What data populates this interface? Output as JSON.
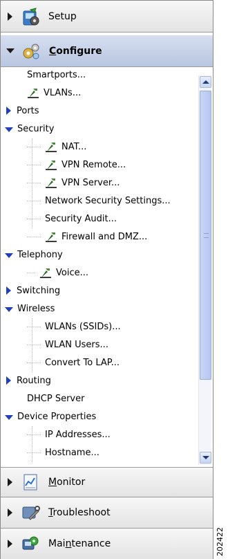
{
  "sections": {
    "setup": {
      "label": "Setup"
    },
    "configure": {
      "label": "Configure",
      "mnemonic": "C",
      "rest": "onfigure"
    },
    "monitor": {
      "mnemonic": "M",
      "rest": "onitor"
    },
    "troubleshoot": {
      "mnemonic": "T",
      "rest": "roubleshoot"
    },
    "maintenance": {
      "pre": "Mai",
      "mnemonic": "n",
      "rest": "tenance"
    }
  },
  "tree": {
    "smartports": "Smartports...",
    "vlans": "VLANs...",
    "ports": "Ports",
    "security": "Security",
    "nat": "NAT...",
    "vpn_remote": "VPN Remote...",
    "vpn_server": "VPN Server...",
    "network_security_settings": "Network Security Settings...",
    "security_audit": "Security Audit...",
    "firewall_dmz": "Firewall and DMZ...",
    "telephony": "Telephony",
    "voice": "Voice...",
    "switching": "Switching",
    "wireless": "Wireless",
    "wlans": "WLANs (SSIDs)...",
    "wlan_users": "WLAN Users...",
    "convert_lap": "Convert To LAP...",
    "routing": "Routing",
    "dhcp_server": "DHCP Server",
    "device_properties": "Device Properties",
    "ip_addresses": "IP Addresses...",
    "hostname": "Hostname..."
  },
  "figure_id": "202422",
  "icons": {
    "setup": "setup-icon",
    "configure": "gears-icon",
    "monitor": "chart-icon",
    "troubleshoot": "wrench-icon",
    "maintenance": "maintenance-icon",
    "task": "tool-icon"
  }
}
